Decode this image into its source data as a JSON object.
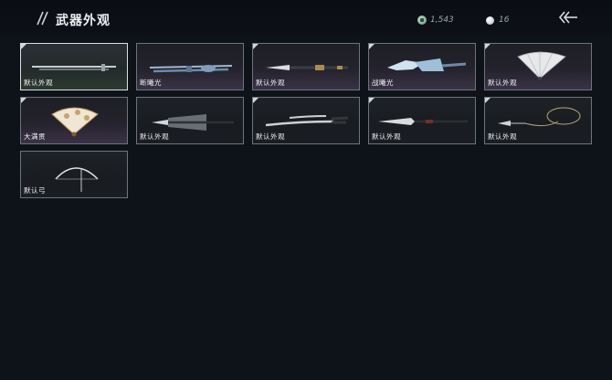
{
  "header": {
    "title": "武器外观",
    "coin_amount": "1,543",
    "pearl_amount": "16"
  },
  "items": [
    {
      "label": "默认外观",
      "icon": "sword-icon"
    },
    {
      "label": "断曦光",
      "icon": "ornate-sword-icon"
    },
    {
      "label": "默认外观",
      "icon": "long-spear-icon"
    },
    {
      "label": "战曦光",
      "icon": "crystal-blade-icon"
    },
    {
      "label": "默认外观",
      "icon": "folding-fan-icon"
    },
    {
      "label": "大满贯",
      "icon": "ornate-fan-icon"
    },
    {
      "label": "默认外观",
      "icon": "tasseled-spear-icon"
    },
    {
      "label": "默认外观",
      "icon": "dual-blades-icon"
    },
    {
      "label": "默认外观",
      "icon": "glaive-icon"
    },
    {
      "label": "默认外观",
      "icon": "rope-dart-icon"
    },
    {
      "label": "默认弓",
      "icon": "bow-icon"
    }
  ],
  "colors": {
    "background": "#0e1219",
    "card_border": "#6e747b",
    "selected_border": "#d9dfe5"
  }
}
